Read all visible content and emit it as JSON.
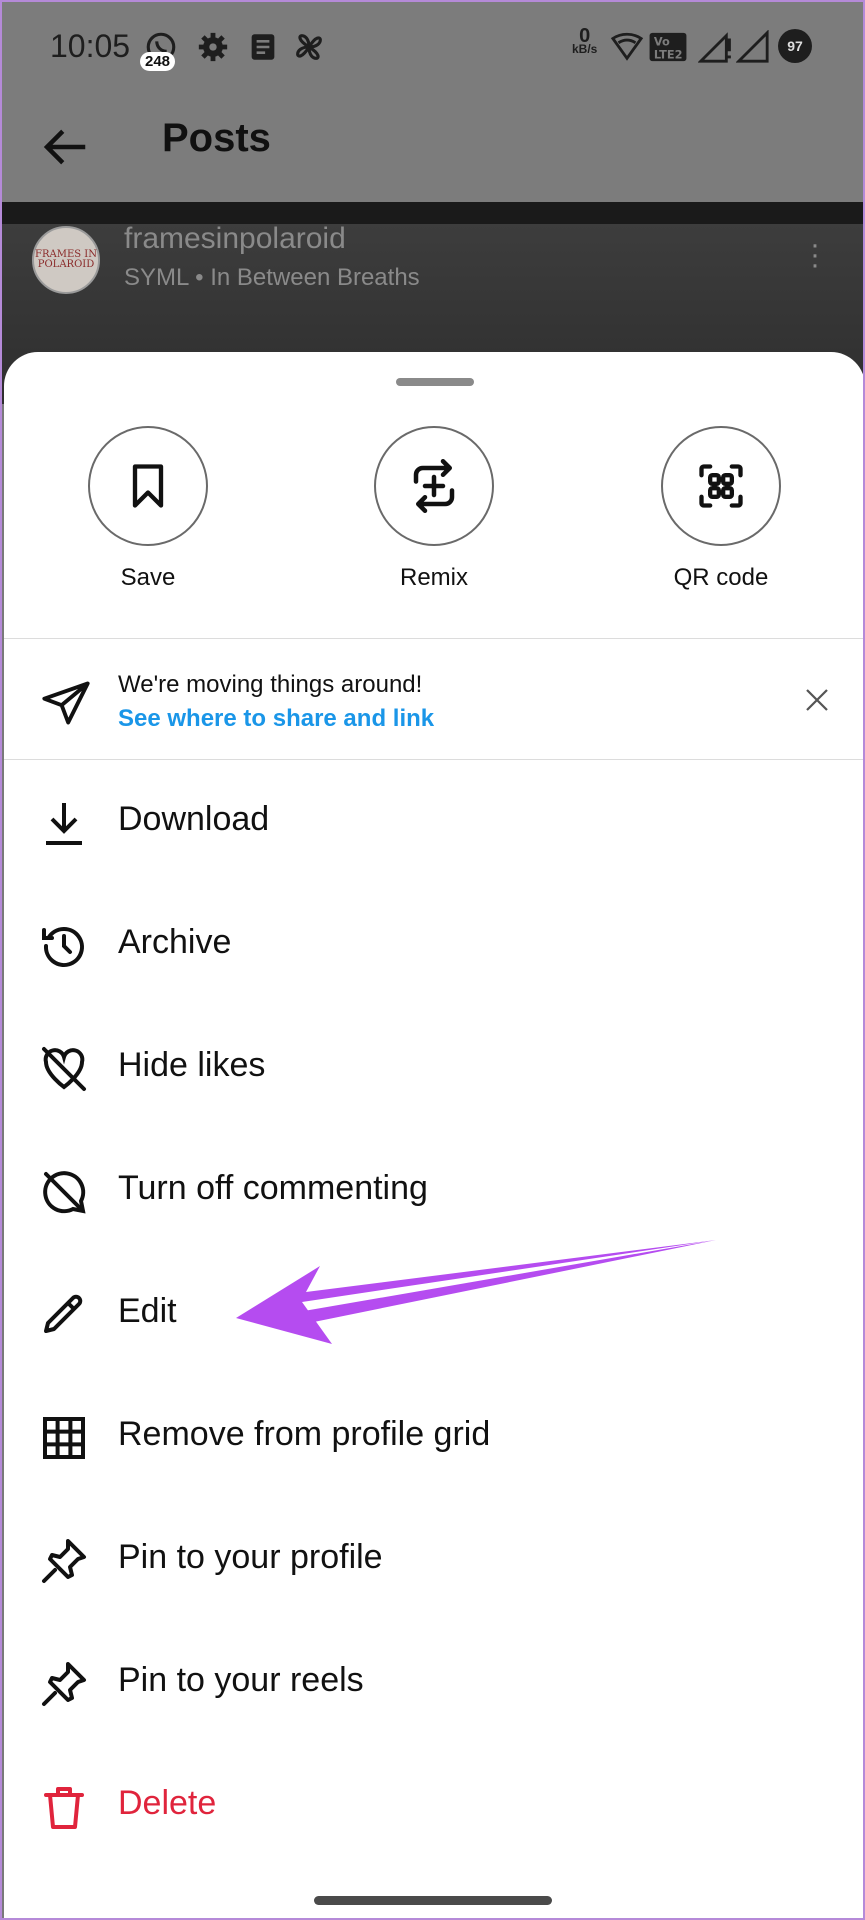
{
  "status_bar": {
    "time": "10:05",
    "whatsapp_badge": "248",
    "net_speed_value": "0",
    "net_speed_unit": "kB/s",
    "volte": "Vo LTE 2",
    "battery": "97"
  },
  "app_bar": {
    "title": "Posts"
  },
  "post": {
    "username": "framesinpolaroid",
    "subtitle": "SYML • In Between Breaths",
    "avatar_text": "FRAMES IN POLAROID"
  },
  "sheet": {
    "quick_actions": [
      {
        "label": "Save",
        "icon": "bookmark-icon"
      },
      {
        "label": "Remix",
        "icon": "remix-icon"
      },
      {
        "label": "QR code",
        "icon": "qr-code-icon"
      }
    ],
    "notice": {
      "text": "We're moving things around!",
      "link": "See where to share and link"
    },
    "menu": [
      {
        "label": "Download",
        "icon": "download-icon"
      },
      {
        "label": "Archive",
        "icon": "archive-icon"
      },
      {
        "label": "Hide likes",
        "icon": "hide-likes-icon"
      },
      {
        "label": "Turn off commenting",
        "icon": "comment-off-icon"
      },
      {
        "label": "Edit",
        "icon": "pencil-icon"
      },
      {
        "label": "Remove from profile grid",
        "icon": "grid-icon"
      },
      {
        "label": "Pin to your profile",
        "icon": "pin-icon"
      },
      {
        "label": "Pin to your reels",
        "icon": "pin-icon"
      },
      {
        "label": "Delete",
        "icon": "trash-icon"
      }
    ]
  },
  "colors": {
    "link": "#1a96e8",
    "danger": "#e0243c",
    "annotation_arrow": "#b54cf0"
  }
}
